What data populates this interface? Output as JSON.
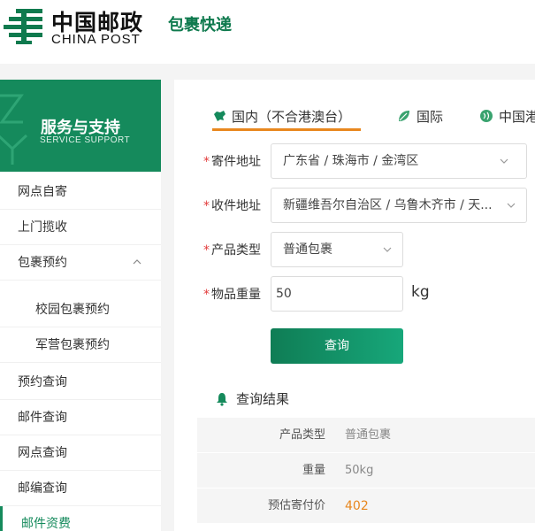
{
  "header": {
    "logo_cn": "中国邮政",
    "logo_en": "CHINA POST",
    "subtitle": "包裹快递"
  },
  "sidebar": {
    "banner_title": "服务与支持",
    "banner_sub": "SERVICE SUPPORT",
    "items": [
      {
        "label": "网点自寄"
      },
      {
        "label": "上门揽收"
      },
      {
        "label": "包裹预约"
      },
      {
        "label": "校园包裹预约"
      },
      {
        "label": "军营包裹预约"
      },
      {
        "label": "预约查询"
      },
      {
        "label": "邮件查询"
      },
      {
        "label": "网点查询"
      },
      {
        "label": "邮编查询"
      },
      {
        "label": "邮件资费"
      }
    ]
  },
  "tabs": [
    {
      "label": "国内（不合港澳台）",
      "active": true
    },
    {
      "label": "国际"
    },
    {
      "label": "中国港"
    }
  ],
  "form": {
    "sender_label": "寄件地址",
    "sender_value": "广东省 / 珠海市 / 金湾区",
    "receiver_label": "收件地址",
    "receiver_value": "新疆维吾尔自治区 / 乌鲁木齐市 / 天...",
    "product_label": "产品类型",
    "product_value": "普通包裹",
    "weight_label": "物品重量",
    "weight_value": "50",
    "weight_unit": "kg",
    "required_mark": "*",
    "query_button": "查询"
  },
  "result": {
    "title": "查询结果",
    "rows": [
      {
        "key": "产品类型",
        "value": "普通包裹"
      },
      {
        "key": "重量",
        "value": "50kg"
      },
      {
        "key": "预估寄付价",
        "value": "402"
      }
    ]
  },
  "colors": {
    "brand_green": "#158a5c",
    "accent_orange": "#e8871e",
    "required_red": "#e23b3b"
  }
}
